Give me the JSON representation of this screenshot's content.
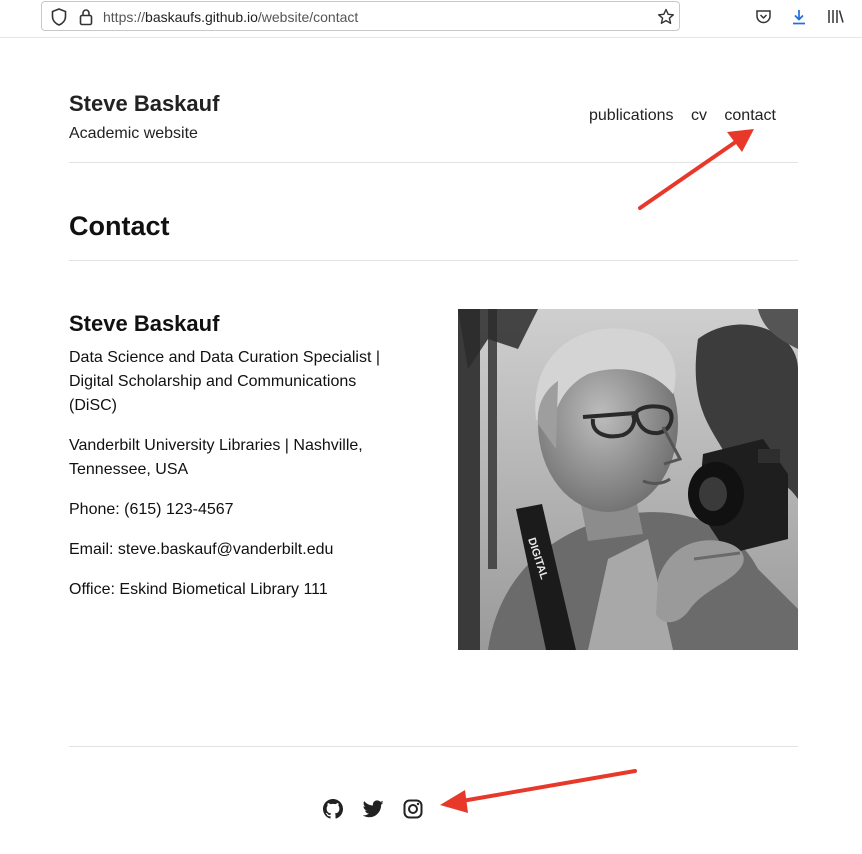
{
  "browser": {
    "url_prefix": "https://",
    "url_host": "baskaufs.github.io",
    "url_path": "/website/contact"
  },
  "site": {
    "title": "Steve Baskauf",
    "tagline": "Academic website"
  },
  "nav": {
    "items": [
      "publications",
      "cv",
      "contact"
    ]
  },
  "page": {
    "heading": "Contact"
  },
  "contact": {
    "name": "Steve Baskauf",
    "role": "Data Science and Data Curation Specialist | Digital Scholarship and Communications (DiSC)",
    "institution": "Vanderbilt University Libraries | Nashville, Tennessee, USA",
    "phone": "Phone: (615) 123-4567",
    "email": "Email: steve.baskauf@vanderbilt.edu",
    "office": "Office: Eskind Biometical Library 111"
  },
  "photo_text": "DIGITAL",
  "footer": {
    "social": [
      "github-icon",
      "twitter-icon",
      "instagram-icon"
    ]
  },
  "colors": {
    "annotation_arrow": "#e8382a",
    "download_icon": "#1e6fd9"
  }
}
